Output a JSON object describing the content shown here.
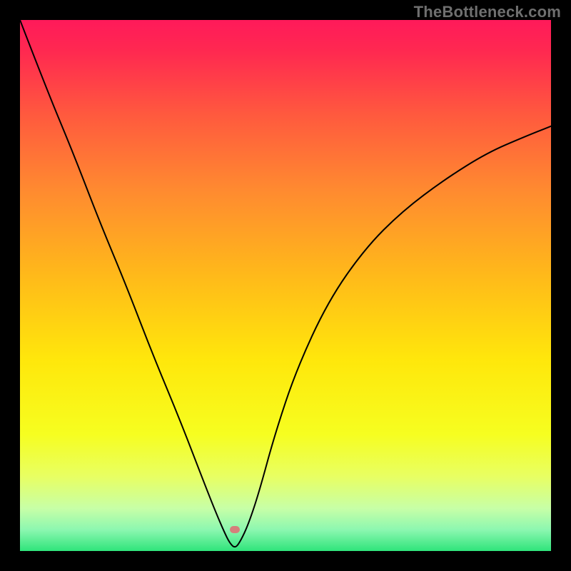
{
  "watermark": "TheBottleneck.com",
  "colors": {
    "frame_background": "#000000",
    "gradient_stops": [
      {
        "offset": 0.0,
        "color": "#ff1a5a"
      },
      {
        "offset": 0.06,
        "color": "#ff2950"
      },
      {
        "offset": 0.18,
        "color": "#ff5a3e"
      },
      {
        "offset": 0.32,
        "color": "#ff8a30"
      },
      {
        "offset": 0.48,
        "color": "#ffb91a"
      },
      {
        "offset": 0.64,
        "color": "#ffe70b"
      },
      {
        "offset": 0.78,
        "color": "#f6fe20"
      },
      {
        "offset": 0.86,
        "color": "#e8ff63"
      },
      {
        "offset": 0.92,
        "color": "#c7ffa7"
      },
      {
        "offset": 0.96,
        "color": "#8cf7b0"
      },
      {
        "offset": 1.0,
        "color": "#2fe47b"
      }
    ],
    "curve_stroke": "#000000",
    "marker_fill": "#d57f7b"
  },
  "marker": {
    "x_pct": 40.5,
    "y_pct": 96.0
  },
  "chart_data": {
    "type": "line",
    "title": "",
    "xlabel": "",
    "ylabel": "",
    "xlim": [
      0,
      100
    ],
    "ylim": [
      0,
      100
    ],
    "grid": false,
    "legend": false,
    "series": [
      {
        "name": "bottleneck-curve",
        "x": [
          0,
          5,
          10,
          15,
          20,
          25,
          30,
          35,
          37,
          38.5,
          39.5,
          40.5,
          41.5,
          43,
          45,
          48,
          52,
          58,
          65,
          72,
          80,
          88,
          95,
          100
        ],
        "y": [
          100,
          87,
          75,
          62,
          50,
          37,
          25,
          12,
          7,
          3.5,
          1.5,
          0.5,
          1.8,
          5,
          11,
          22,
          34,
          47,
          57,
          64,
          70,
          75,
          78,
          80
        ]
      }
    ],
    "annotations": [
      {
        "name": "minimum-marker",
        "x": 40.5,
        "y": 0.5
      }
    ],
    "notes": "Values estimated from pixel positions; axes are unlabeled percentage scales (0–100)."
  }
}
